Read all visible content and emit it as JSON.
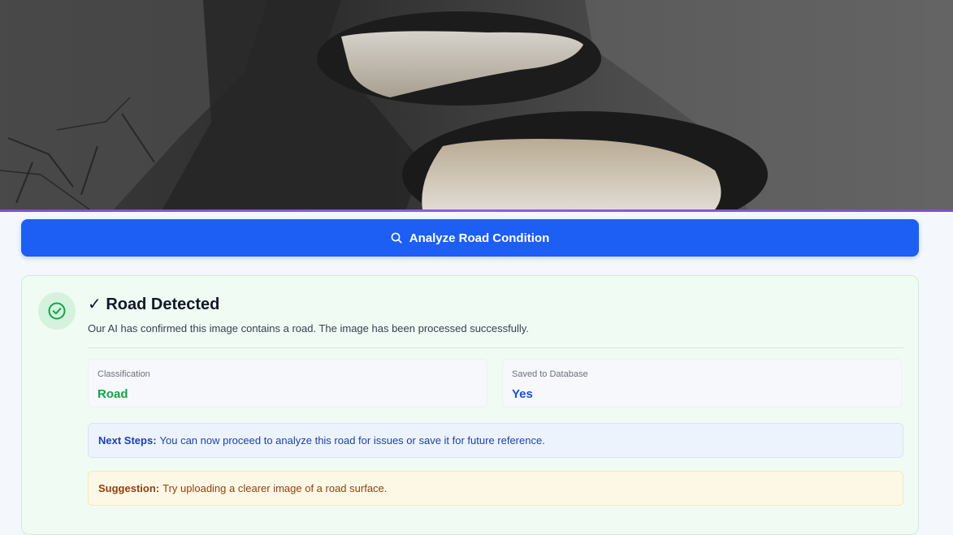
{
  "colors": {
    "primary_button": "#1d5ff5",
    "photo_border": "#8b5cf6",
    "success_bg": "#f0fbf3",
    "success_icon": "#16a34a",
    "info_blue": "#1d4ed8",
    "suggestion_brown": "#92400e"
  },
  "uploaded_image": {
    "icon": "road-pothole-photo"
  },
  "analyze_button": {
    "icon": "search-icon",
    "label": "Analyze Road Condition"
  },
  "result": {
    "icon": "check-circle-icon",
    "title": "✓ Road Detected",
    "description": "Our AI has confirmed this image contains a road. The image has been processed successfully.",
    "classification": {
      "label": "Classification",
      "value": "Road"
    },
    "saved": {
      "label": "Saved to Database",
      "value": "Yes"
    },
    "next_steps": {
      "heading": "Next Steps:",
      "text": "You can now proceed to analyze this road for issues or save it for future reference."
    },
    "suggestion": {
      "heading": "Suggestion:",
      "text": "Try uploading a clearer image of a road surface."
    }
  }
}
